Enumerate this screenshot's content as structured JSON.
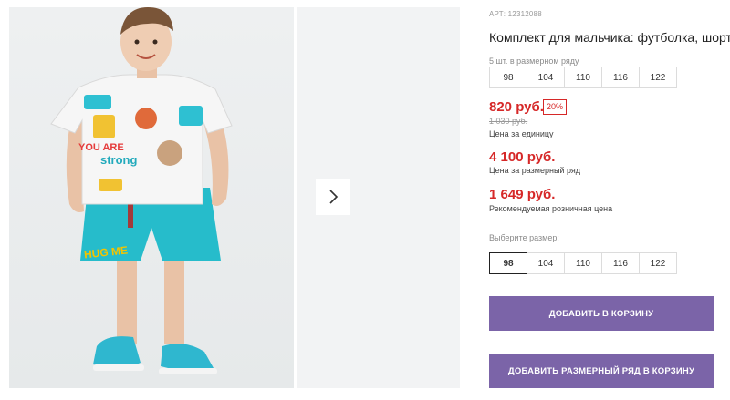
{
  "gallery": {
    "next_icon": "chevron-right-icon",
    "shirt_print_lines": [
      "YOU ARE",
      "strong"
    ],
    "shorts_print": "HUG ME"
  },
  "product": {
    "article": "АРТ: 12312088",
    "title": "Комплект для мальчика: футболка, шорты",
    "row_hint": "5 шт. в размерном ряду",
    "row_sizes": [
      "98",
      "104",
      "110",
      "116",
      "122"
    ],
    "price_unit": "820 руб.",
    "discount_badge": "20%",
    "old_price": "1 030 руб.",
    "price_unit_caption": "Цена за единицу",
    "price_row": "4 100 руб.",
    "price_row_caption": "Цена за размерный ряд",
    "price_retail": "1 649 руб.",
    "price_retail_caption": "Рекомендуемая розничная цена",
    "choose_size_label": "Выберите размер:",
    "choose_sizes": [
      "98",
      "104",
      "110",
      "116",
      "122"
    ],
    "selected_size": "98",
    "add_to_cart": "ДОБАВИТЬ В КОРЗИНУ",
    "add_row_to_cart": "ДОБАВИТЬ РАЗМЕРНЫЙ РЯД В КОРЗИНУ"
  },
  "colors": {
    "accent_button": "#7b64a8",
    "price_red": "#d62828",
    "shorts_turquoise": "#26bccb"
  }
}
